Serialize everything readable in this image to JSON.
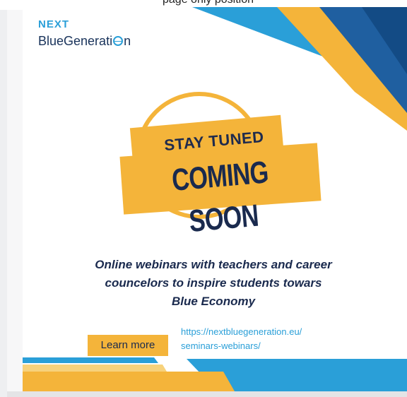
{
  "caption": {
    "text": "page only position"
  },
  "logo": {
    "top_word": "NEXT",
    "bottom_word_a": "BlueGenerati",
    "bottom_word_b": "n"
  },
  "banner": {
    "stay_tuned": "STAY TUNED",
    "coming_soon": "COMING SOON"
  },
  "description": {
    "line1": "Online webinars with teachers and career",
    "line2": "councelors to inspire students towars",
    "line3": "Blue Economy"
  },
  "cta": {
    "button_label": "Learn more",
    "link_line1": "https://nextbluegeneration.eu/",
    "link_line2": "seminars-webinars/"
  },
  "colors": {
    "navy": "#1a2a4e",
    "sky_blue": "#2a9fd8",
    "gold": "#f4b43a",
    "deep_blue": "#1f5fa0"
  },
  "icons": [
    "water-wave-o-icon"
  ]
}
